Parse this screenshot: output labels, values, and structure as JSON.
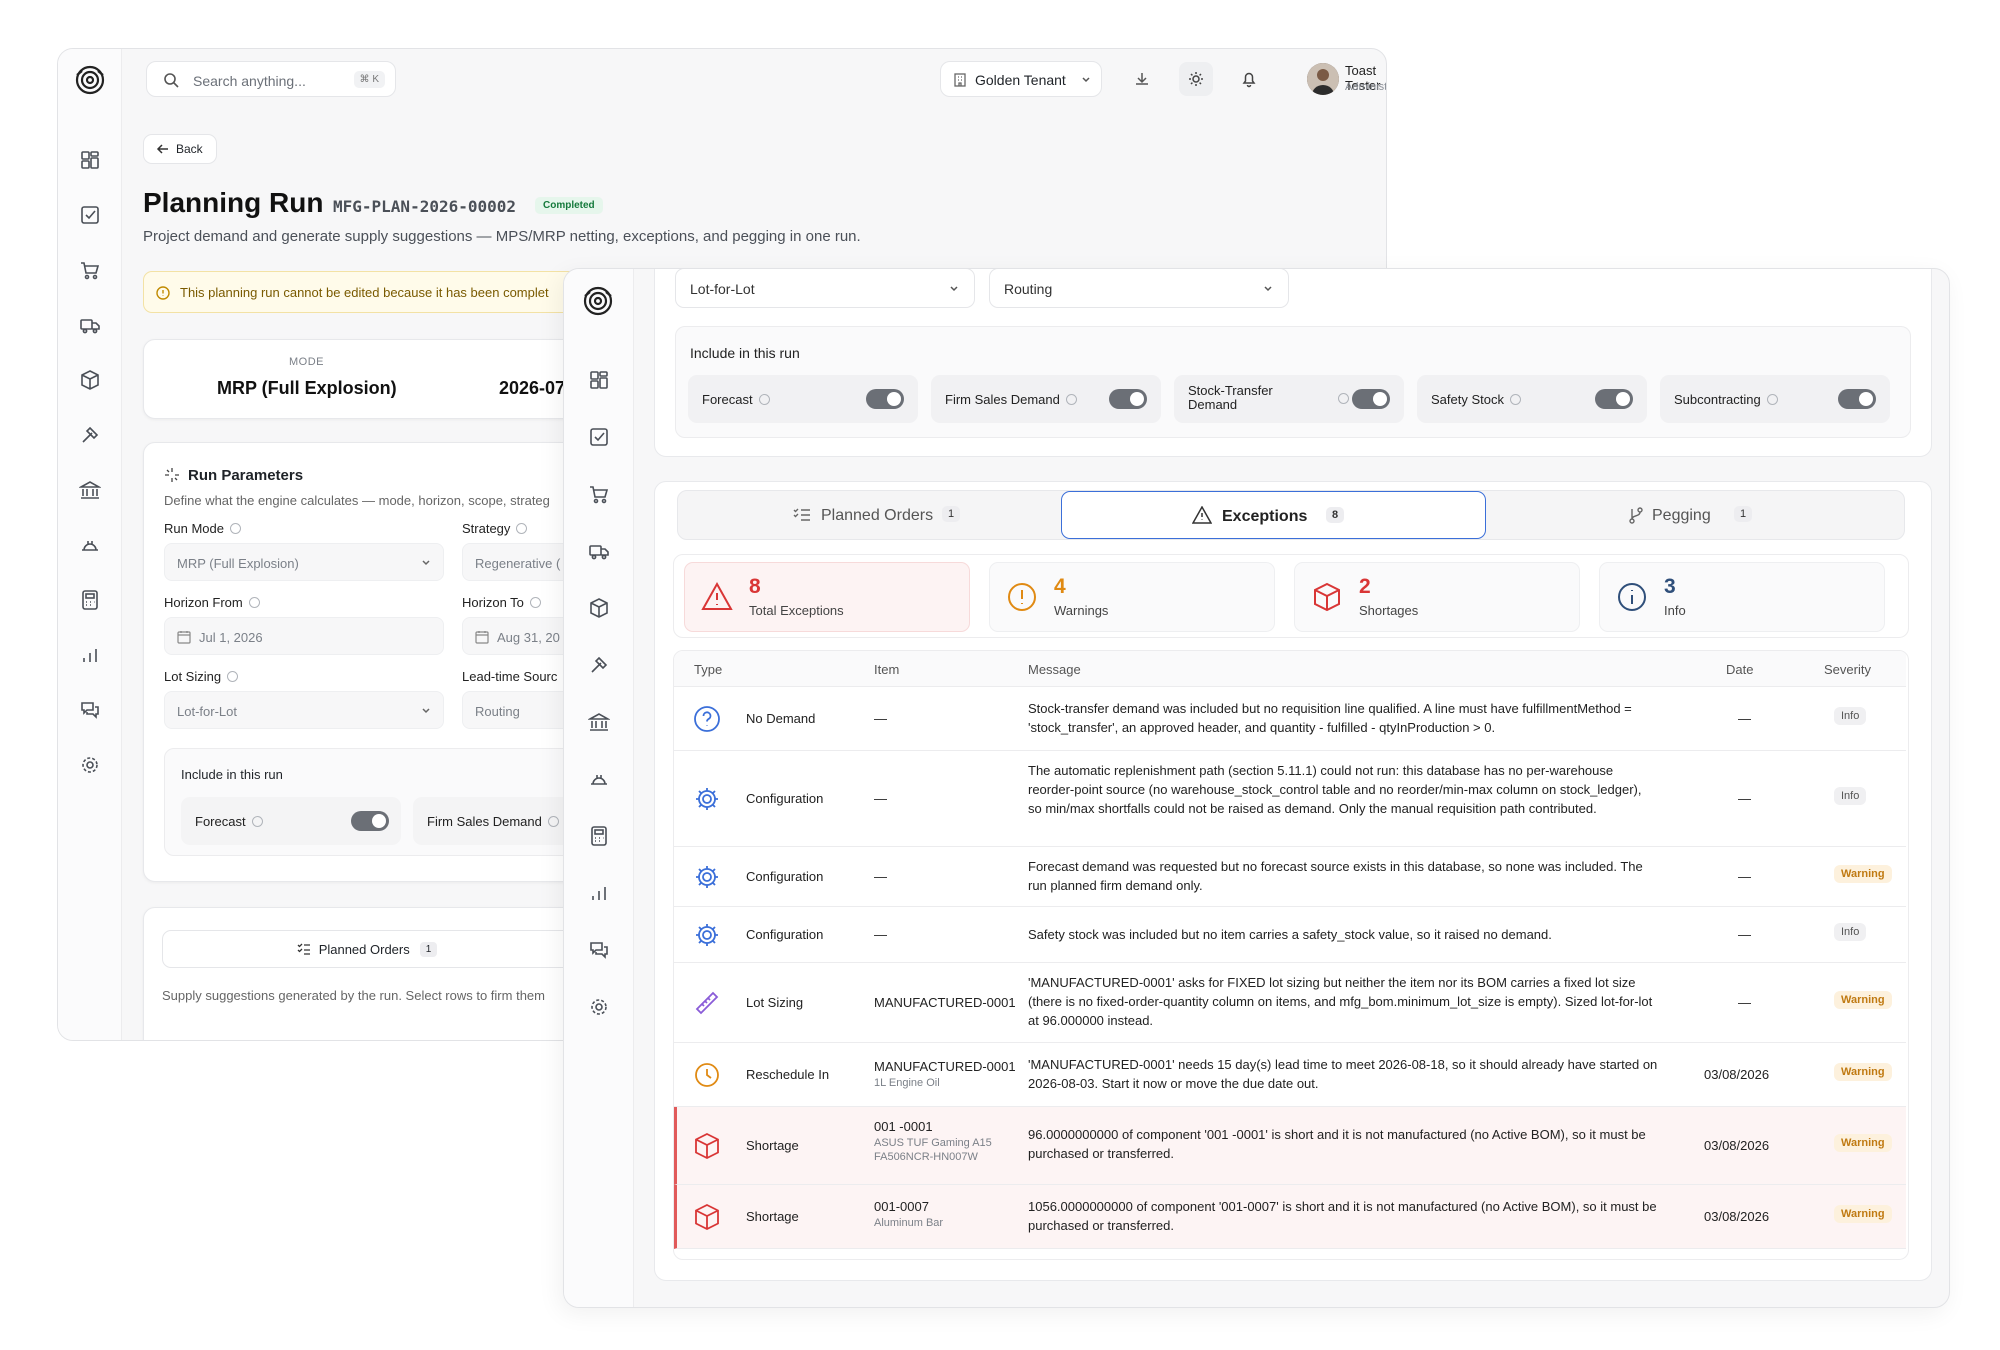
{
  "back_window": {
    "search": {
      "placeholder": "Search anything...",
      "shortcut": "⌘ K"
    },
    "tenant": "Golden Tenant",
    "user": {
      "name": "Toast Tester",
      "role": "Administration"
    },
    "back_label": "Back",
    "title": "Planning Run",
    "code": "MFG-PLAN-2026-00002",
    "status": "Completed",
    "subtitle": "Project demand and generate supply suggestions — MPS/MRP netting, exceptions, and pegging in one run.",
    "alert": "This planning run cannot be edited because it has been complet",
    "summary": {
      "mode_label": "MODE",
      "mode_value": "MRP (Full Explosion)",
      "date_value": "2026-07"
    },
    "params": {
      "title": "Run Parameters",
      "desc": "Define what the engine calculates — mode, horizon, scope, strateg",
      "run_mode_label": "Run Mode",
      "run_mode_value": "MRP (Full Explosion)",
      "strategy_label": "Strategy",
      "strategy_value": "Regenerative (",
      "horizon_from_label": "Horizon From",
      "horizon_from_value": "Jul 1, 2026",
      "horizon_to_label": "Horizon To",
      "horizon_to_value": "Aug 31, 20",
      "lot_sizing_label": "Lot Sizing",
      "lot_sizing_value": "Lot-for-Lot",
      "lead_time_label": "Lead-time Sourc",
      "lead_time_value": "Routing",
      "include_title": "Include in this run",
      "forecast": "Forecast",
      "firm_sales": "Firm Sales Demand"
    },
    "planned_tab": {
      "label": "Planned Orders",
      "count": "1"
    },
    "planned_desc": "Supply suggestions generated by the run. Select rows to firm them"
  },
  "front_window": {
    "lot_sizing": "Lot-for-Lot",
    "lead_time": "Routing",
    "include_title": "Include in this run",
    "toggles": [
      "Forecast",
      "Firm Sales Demand",
      "Stock-Transfer Demand",
      "Safety Stock",
      "Subcontracting"
    ],
    "tabs": [
      {
        "label": "Planned Orders",
        "count": "1"
      },
      {
        "label": "Exceptions",
        "count": "8"
      },
      {
        "label": "Pegging",
        "count": "1"
      }
    ],
    "stats": [
      {
        "num": "8",
        "cap": "Total Exceptions",
        "color": "#d93636"
      },
      {
        "num": "4",
        "cap": "Warnings",
        "color": "#e08a13"
      },
      {
        "num": "2",
        "cap": "Shortages",
        "color": "#d93636"
      },
      {
        "num": "3",
        "cap": "Info",
        "color": "#2f4f7a"
      }
    ],
    "table": {
      "headers": {
        "type": "Type",
        "item": "Item",
        "message": "Message",
        "date": "Date",
        "severity": "Severity"
      },
      "rows": [
        {
          "type": "No Demand",
          "icon": "question-icon",
          "item": "—",
          "item_sub": "",
          "message": "Stock-transfer demand was included but no requisition line qualified. A line must have fulfillmentMethod = 'stock_transfer', an approved header, and quantity - fulfilled - qtyInProduction > 0.",
          "date": "—",
          "severity": "Info"
        },
        {
          "type": "Configuration",
          "icon": "gear-icon",
          "item": "—",
          "item_sub": "",
          "message": "The automatic replenishment path (section 5.11.1) could not run: this database has no per-warehouse reorder-point source (no warehouse_stock_control table and no reorder/min-max column on stock_ledger), so min/max shortfalls could not be raised as demand. Only the manual requisition path contributed.",
          "date": "—",
          "severity": "Info"
        },
        {
          "type": "Configuration",
          "icon": "gear-icon",
          "item": "—",
          "item_sub": "",
          "message": "Forecast demand was requested but no forecast source exists in this database, so none was included. The run planned firm demand only.",
          "date": "—",
          "severity": "Warning"
        },
        {
          "type": "Configuration",
          "icon": "gear-icon",
          "item": "—",
          "item_sub": "",
          "message": "Safety stock was included but no item carries a safety_stock value, so it raised no demand.",
          "date": "—",
          "severity": "Info"
        },
        {
          "type": "Lot Sizing",
          "icon": "ruler-icon",
          "item": "MANUFACTURED-0001",
          "item_sub": "",
          "message": "'MANUFACTURED-0001' asks for FIXED lot sizing but neither the item nor its BOM carries a fixed lot size (there is no fixed-order-quantity column on items, and mfg_bom.minimum_lot_size is empty). Sized lot-for-lot at 96.000000 instead.",
          "date": "—",
          "severity": "Warning"
        },
        {
          "type": "Reschedule In",
          "icon": "clock-icon",
          "item": "MANUFACTURED-0001",
          "item_sub": "1L Engine Oil",
          "message": "'MANUFACTURED-0001' needs 15 day(s) lead time to meet 2026-08-18, so it should already have started on 2026-08-03. Start it now or move the due date out.",
          "date": "03/08/2026",
          "severity": "Warning"
        },
        {
          "type": "Shortage",
          "icon": "box-icon",
          "item": "001 -0001",
          "item_sub": "ASUS TUF Gaming A15 FA506NCR-HN007W",
          "message": "96.0000000000 of component '001 -0001' is short and it is not manufactured (no Active BOM), so it must be purchased or transferred.",
          "date": "03/08/2026",
          "severity": "Warning"
        },
        {
          "type": "Shortage",
          "icon": "box-icon",
          "item": "001-0007",
          "item_sub": "Aluminum Bar",
          "message": "1056.0000000000 of component '001-0007' is short and it is not manufactured (no Active BOM), so it must be purchased or transferred.",
          "date": "03/08/2026",
          "severity": "Warning"
        }
      ]
    }
  }
}
